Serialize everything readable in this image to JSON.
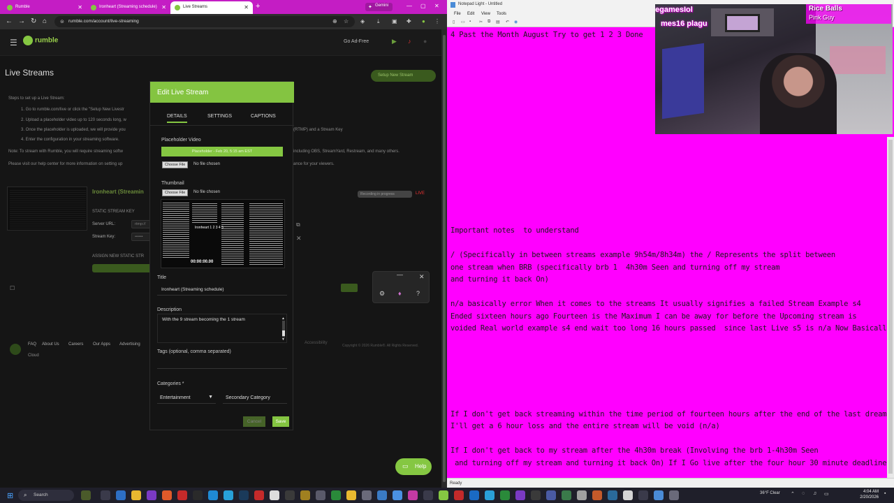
{
  "browser": {
    "tabs": [
      {
        "label": "Rumble"
      },
      {
        "label": "Ironheart (Streaming schedule)"
      },
      {
        "label": "Live Streams"
      }
    ],
    "gemini_label": "Gemini",
    "url": "rumble.com/account/live-streaming"
  },
  "rumble": {
    "go_ad_free": "Go Ad-Free",
    "page_title": "Live Streams",
    "setup_button": "Setup New Stream",
    "steps_title": "Steps to set up a Live Stream:",
    "step1": "1. Go to rumble.com/live or click the \"Setup New Livestr",
    "step2": "2. Upload a placeholder video up to 120 seconds long, w",
    "step3": "3. Once the placeholder is uploaded, we will provide you",
    "step3_tail": "(RTMP) and a Stream Key",
    "step4": "4. Enter the configuration in your streaming software.",
    "note": "Note: To stream with Rumble, you will require streaming softw",
    "note_tail": "including OBS, StreamYard, Restream, and many others.",
    "help_line": "Please visit our help center for more information on setting up",
    "help_tail": "ance for your viewers.",
    "stream_name": "Ironheart (Streamin",
    "rec_badge": "Recording in progress",
    "live_badge": "LIVE",
    "static_key_label": "STATIC STREAM KEY",
    "server_url_label": "Server URL:",
    "server_url_value": "rtmp://",
    "stream_key_label": "Stream Key:",
    "stream_key_value": "••••••",
    "assign_label": "ASSIGN NEW STATIC STR",
    "footer_links": [
      "FAQ",
      "About Us",
      "Careers",
      "Our Apps",
      "Advertising"
    ],
    "footer_cloud": "Cloud",
    "footer_a11y": "Accessibility",
    "copyright": "Copyright © 2026 Rumble®. All Rights Reserved.",
    "help_button": "Help"
  },
  "modal": {
    "title": "Edit Live Stream",
    "tabs": [
      "DETAILS",
      "SETTINGS",
      "CAPTIONS"
    ],
    "placeholder_label": "Placeholder Video",
    "placeholder_value": "Placeholder - Feb 20, 5:15 am EST",
    "choose_file": "Choose File",
    "no_file": "No file chosen",
    "thumbnail_label": "Thumbnail",
    "thumb_time": "00:00:00.00",
    "thumb_name": "Ironheart 1 2 3 4 5",
    "title_label": "Title",
    "title_value": "Ironheart (Streaming schedule)",
    "description_label": "Description",
    "description_value": "With the 9 stream becoming the 1 stream",
    "tags_label": "Tags (optional, comma separated)",
    "categories_label": "Categories *",
    "category_primary": "Entertainment",
    "category_secondary": "Secondary Category",
    "cancel": "Cancel",
    "save": "Save"
  },
  "notepad": {
    "title": "Notepad Light - Untitled",
    "menu": [
      "File",
      "Edit",
      "View",
      "Tools"
    ],
    "lines": [
      "4 Past the Month August Try to get 1 2 3 Done",
      "Important notes  to understand",
      "/ (Specifically in between streams example 9h54m/8h34m) the / Represents the split between",
      "one stream when BRB (specifically brb 1  4h30m Seen and turning off my stream",
      "and turning it back On)",
      "n/a basically error When it comes to the streams It usually signifies a failed Stream Example s4",
      "Ended sixteen hours ago Fourteen is the Maximum I can be away for before the Upcoming stream is",
      "voided Real world example s4 end wait too long 16 hours passed  since last Live s5 is n/a Now Basically s",
      "If I don't get back streaming within the time period of fourteen hours after the end of the last dream",
      "I'll get a 6 hour loss and the entire stream will be void (n/a)",
      "If I don't get back to my stream after the 4h30m break (Involving the brb 1-4h30m Seen",
      " and turning off my stream and turning it back On) If I Go live after the four hour 30 minute deadline"
    ],
    "status": "Ready"
  },
  "webcam": {
    "chat_line1": "egamesIol",
    "chat_line2": "mes16 plagu",
    "label_line1": "Rice Balls",
    "label_line2": "Pink Guy"
  },
  "taskbar": {
    "search": "Search",
    "weather": "36°F Clear",
    "time": "4:04 AM",
    "date": "2/20/2026"
  }
}
